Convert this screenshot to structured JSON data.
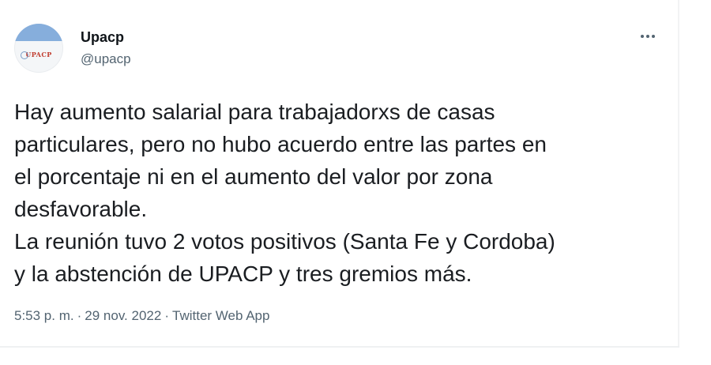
{
  "tweet": {
    "author": {
      "display_name": "Upacp",
      "handle": "@upacp",
      "avatar_logo_text": "UPACP",
      "avatar_icon": "organization-logo-avatar"
    },
    "more_icon": "more-horizontal-icon",
    "text_lines": [
      "Hay aumento salarial para trabajadorxs de casas",
      "particulares, pero no hubo acuerdo entre las partes en",
      "el porcentaje ni en el aumento del valor por zona",
      "desfavorable.",
      "La reunión tuvo 2 votos positivos (Santa Fe y Cordoba)",
      "y la abstención de UPACP y tres gremios más."
    ],
    "time": "5:53 p. m.",
    "separator": "·",
    "date": "29 nov. 2022",
    "source": "Twitter Web App"
  },
  "colors": {
    "text_primary": "#0f1419",
    "text_secondary": "#536471",
    "avatar_band": "#86aedc",
    "logo_red": "#c0392b"
  }
}
